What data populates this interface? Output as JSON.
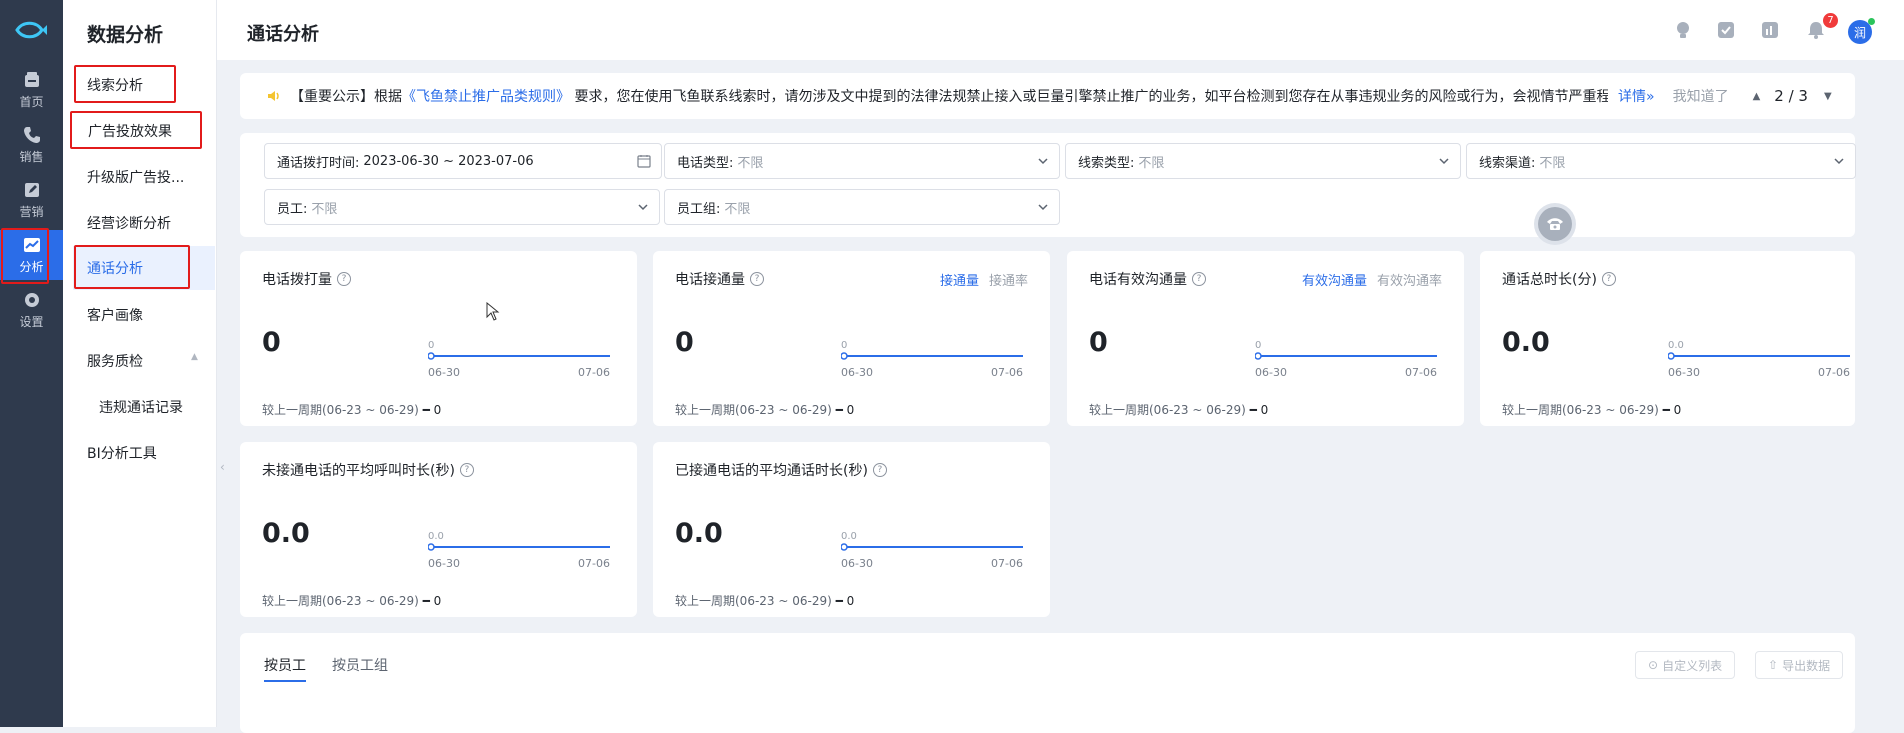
{
  "rail": {
    "items": [
      {
        "label": "首页",
        "icon": "home-icon"
      },
      {
        "label": "销售",
        "icon": "phone-icon"
      },
      {
        "label": "营销",
        "icon": "edit-icon"
      },
      {
        "label": "分析",
        "icon": "chart-icon"
      },
      {
        "label": "设置",
        "icon": "gear-icon"
      }
    ],
    "active_color": "#2b6de8"
  },
  "subnav": {
    "title": "数据分析",
    "items": [
      {
        "label": "线索分析"
      },
      {
        "label": "广告投放效果"
      },
      {
        "label": "升级版广告投..."
      },
      {
        "label": "经营诊断分析"
      },
      {
        "label": "通话分析"
      },
      {
        "label": "客户画像"
      },
      {
        "label": "服务质检"
      },
      {
        "label": "违规通话记录"
      },
      {
        "label": "BI分析工具"
      }
    ]
  },
  "header": {
    "title": "通话分析",
    "notification_count": "7",
    "avatar_text": "润"
  },
  "notice": {
    "prefix": "【重要公示】根据",
    "link": "《飞鱼禁止推广品类规则》",
    "body": "要求，您在使用飞鱼联系线索时，请勿涉及文中提到的法律法规禁止接入或巨量引擎禁止推广的业务，如平台检测到您存在从事违规业务的风险或行为，会视情节严重程...",
    "detail": "详情»",
    "dismiss": "我知道了",
    "page": "2 / 3"
  },
  "filters": {
    "date": {
      "label": "通话拨打时间:",
      "value": "2023-06-30 ~ 2023-07-06"
    },
    "phone_type": {
      "label": "电话类型:",
      "value": "不限"
    },
    "lead_type": {
      "label": "线索类型:",
      "value": "不限"
    },
    "lead_channel": {
      "label": "线索渠道:",
      "value": "不限"
    },
    "employee": {
      "label": "员工:",
      "value": "不限"
    },
    "employee_group": {
      "label": "员工组:",
      "value": "不限"
    }
  },
  "cards": [
    {
      "title": "电话拨打量",
      "value": "0",
      "spark_label": "0",
      "x_start": "06-30",
      "x_end": "07-06",
      "compare": "较上一周期(06-23 ~ 06-29)",
      "compare_value": "━ 0"
    },
    {
      "title": "电话接通量",
      "value": "0",
      "spark_label": "0",
      "x_start": "06-30",
      "x_end": "07-06",
      "compare": "较上一周期(06-23 ~ 06-29)",
      "compare_value": "━ 0",
      "tab_on": "接通量",
      "tab_off": "接通率"
    },
    {
      "title": "电话有效沟通量",
      "value": "0",
      "spark_label": "0",
      "x_start": "06-30",
      "x_end": "07-06",
      "compare": "较上一周期(06-23 ~ 06-29)",
      "compare_value": "━ 0",
      "tab_on": "有效沟通量",
      "tab_off": "有效沟通率"
    },
    {
      "title": "通话总时长(分)",
      "value": "0.0",
      "spark_label": "0.0",
      "x_start": "06-30",
      "x_end": "07-06",
      "compare": "较上一周期(06-23 ~ 06-29)",
      "compare_value": "━ 0"
    },
    {
      "title": "未接通电话的平均呼叫时长(秒)",
      "value": "0.0",
      "spark_label": "0.0",
      "x_start": "06-30",
      "x_end": "07-06",
      "compare": "较上一周期(06-23 ~ 06-29)",
      "compare_value": "━ 0"
    },
    {
      "title": "已接通电话的平均通话时长(秒)",
      "value": "0.0",
      "spark_label": "0.0",
      "x_start": "06-30",
      "x_end": "07-06",
      "compare": "较上一周期(06-23 ~ 06-29)",
      "compare_value": "━ 0"
    }
  ],
  "bottom": {
    "tabs": [
      {
        "label": "按员工"
      },
      {
        "label": "按员工组"
      }
    ],
    "custom_columns": "自定义列表",
    "export": "导出数据"
  }
}
